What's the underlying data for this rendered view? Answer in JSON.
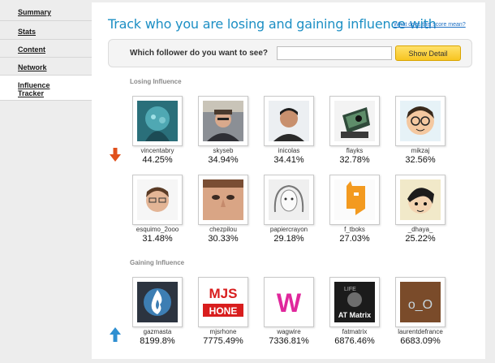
{
  "sidebar": {
    "items": [
      {
        "label": "Summary"
      },
      {
        "label": "Stats"
      },
      {
        "label": "Content"
      },
      {
        "label": "Network"
      },
      {
        "label": "Influence\nTracker"
      }
    ]
  },
  "header": {
    "title": "Track who you are losing and gaining influence with",
    "help_link": "What does this score mean?"
  },
  "search": {
    "label": "Which follower do you want to see?",
    "value": "",
    "placeholder": "",
    "button": "Show Detail"
  },
  "losing": {
    "label": "Losing Influence",
    "users": [
      {
        "name": "vincentabry",
        "pct": "44.25%"
      },
      {
        "name": "skyseb",
        "pct": "34.94%"
      },
      {
        "name": "inicolas",
        "pct": "34.41%"
      },
      {
        "name": "flayks",
        "pct": "32.78%"
      },
      {
        "name": "mikzaj",
        "pct": "32.56%"
      },
      {
        "name": "esquimo_2ooo",
        "pct": "31.48%"
      },
      {
        "name": "chezpilou",
        "pct": "30.33%"
      },
      {
        "name": "papiercrayon",
        "pct": "29.18%"
      },
      {
        "name": "f_tboks",
        "pct": "27.03%"
      },
      {
        "name": "_dhaya_",
        "pct": "25.22%"
      }
    ]
  },
  "gaining": {
    "label": "Gaining Influence",
    "users": [
      {
        "name": "gazmasta",
        "pct": "8199.8%"
      },
      {
        "name": "mjsrhone",
        "pct": "7775.49%"
      },
      {
        "name": "wagwire",
        "pct": "7336.81%"
      },
      {
        "name": "fatmatrix",
        "pct": "6876.46%"
      },
      {
        "name": "laurentdefrance",
        "pct": "6683.09%"
      }
    ]
  },
  "avatar_text": {
    "mjs_top": "MJS",
    "mjs_bottom": "HONE",
    "wagwire": "W",
    "fatmatrix_top": "LIFE",
    "fatmatrix_bottom": "AT Matrix",
    "laurent": "o_O"
  },
  "colors": {
    "title": "#1c8fc4",
    "link": "#1c6fc4",
    "button": "#f7c521",
    "arrow_down": "#e0501c",
    "arrow_up": "#2f8fd1"
  },
  "icons": {
    "down_arrow": "red-down-arrow-icon",
    "up_arrow": "blue-up-arrow-icon"
  }
}
